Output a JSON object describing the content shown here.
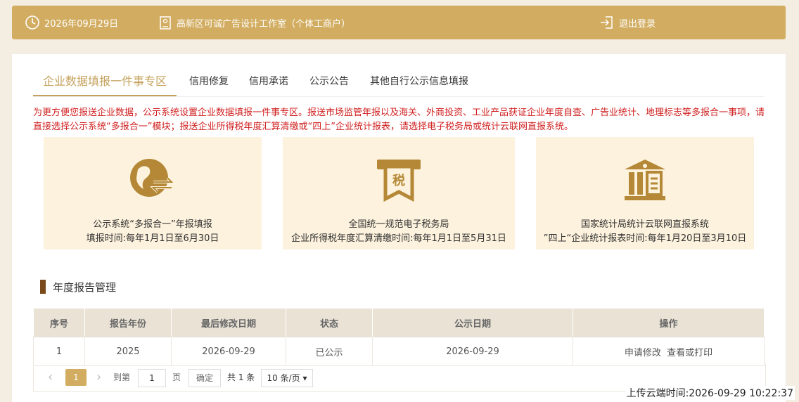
{
  "topbar": {
    "date": "2026年09月29日",
    "company": "高新区可诚广告设计工作室（个体工商户）",
    "logout": "退出登录"
  },
  "tabs": [
    {
      "label": "企业数据填报一件事专区",
      "active": true
    },
    {
      "label": "信用修复"
    },
    {
      "label": "信用承诺"
    },
    {
      "label": "公示公告"
    },
    {
      "label": "其他自行公示信息填报"
    }
  ],
  "notice": "为更方便您报送企业数据，公示系统设置企业数据填报一件事专区。报送市场监管年报以及海关、外商投资、工业产品获证企业年度自查、广告业统计、地理标志等多报合一事项，请直接选择公示系统“多报合一”模块；报送企业所得税年度汇算清缴或“四上”企业统计报表，请选择电子税务局或统计云联网直报系统。",
  "tiles": [
    {
      "line1": "公示系统“多报合一”年报填报",
      "line2": "填报时间:每年1月1日至6月30日"
    },
    {
      "icon_text": "税",
      "line1": "全国统一规范电子税务局",
      "line2": "企业所得税年度汇算清缴时间:每年1月1日至5月31日"
    },
    {
      "line1": "国家统计局统计云联网直报系统",
      "line2": "”四上“企业统计报表时间:每年1月20日至3月10日"
    }
  ],
  "section_title": "年度报告管理",
  "table": {
    "headers": [
      "序号",
      "报告年份",
      "最后修改日期",
      "状态",
      "公示日期",
      "操作"
    ],
    "rows": [
      {
        "no": "1",
        "year": "2025",
        "modified": "2026-09-29",
        "status": "已公示",
        "pub_date": "2026-09-29",
        "action1": "申请修改",
        "action2": "查看或打印"
      }
    ]
  },
  "pager": {
    "prev": "‹",
    "page": "1",
    "next": "›",
    "goto": "到第",
    "input": "1",
    "page_unit": "页",
    "confirm": "确定",
    "total": "共 1 条",
    "size": "10 条/页"
  },
  "upload_time": "上传云端时间:2026-09-29 10:22:37",
  "colors": {
    "accent": "#d2ad61",
    "notice": "#d02020",
    "tile_bg": "#fdf2dd"
  }
}
